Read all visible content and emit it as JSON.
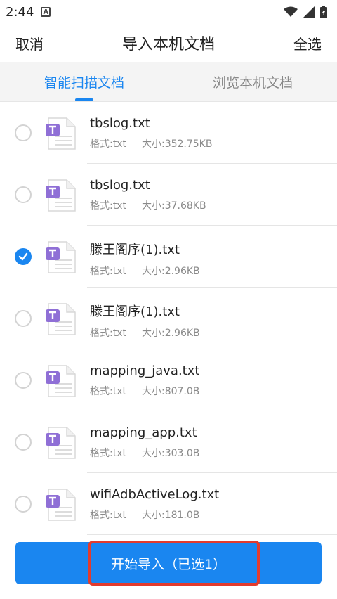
{
  "status": {
    "time": "2:44",
    "notif_letter": "A"
  },
  "topbar": {
    "cancel": "取消",
    "title": "导入本机文档",
    "select_all": "全选"
  },
  "tabs": [
    {
      "label": "智能扫描文档",
      "active": true
    },
    {
      "label": "浏览本机文档",
      "active": false
    }
  ],
  "files": [
    {
      "name": "tbslog.txt",
      "format": "格式:txt",
      "size": "大小:352.75KB",
      "checked": false
    },
    {
      "name": "tbslog.txt",
      "format": "格式:txt",
      "size": "大小:37.68KB",
      "checked": false
    },
    {
      "name": "滕王阁序(1).txt",
      "format": "格式:txt",
      "size": "大小:2.96KB",
      "checked": true
    },
    {
      "name": "滕王阁序(1).txt",
      "format": "格式:txt",
      "size": "大小:2.96KB",
      "checked": false
    },
    {
      "name": "mapping_java.txt",
      "format": "格式:txt",
      "size": "大小:807.0B",
      "checked": false
    },
    {
      "name": "mapping_app.txt",
      "format": "格式:txt",
      "size": "大小:303.0B",
      "checked": false
    },
    {
      "name": "wifiAdbActiveLog.txt",
      "format": "格式:txt",
      "size": "大小:181.0B",
      "checked": false
    }
  ],
  "action": {
    "label": "开始导入（已选1）"
  },
  "colors": {
    "accent": "#1a86f0",
    "icon_purple": "#8f6fd6",
    "highlight": "#e23b2e"
  },
  "icons": {
    "file": "txt-file-icon",
    "check": "check-icon",
    "wifi": "wifi-icon",
    "signal": "signal-icon",
    "battery": "battery-icon"
  }
}
